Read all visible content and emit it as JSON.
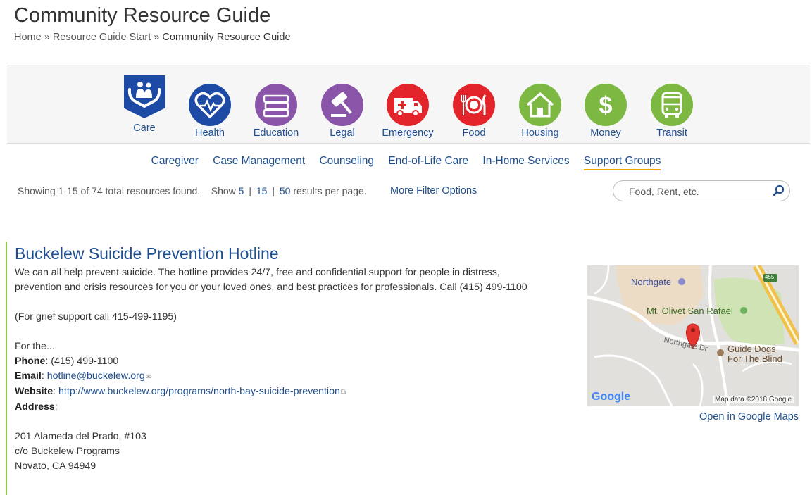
{
  "page": {
    "title": "Community Resource Guide",
    "breadcrumb": {
      "home": "Home",
      "sep1": "»",
      "start": "Resource Guide Start",
      "sep2": "»",
      "current": "Community Resource Guide"
    }
  },
  "categories": [
    {
      "label": "Care",
      "color": "#1d4aa4",
      "icon": "care-hands-icon",
      "active": true
    },
    {
      "label": "Health",
      "color": "#1d4aa4",
      "icon": "heart-pulse-icon"
    },
    {
      "label": "Education",
      "color": "#8a55a9",
      "icon": "books-icon"
    },
    {
      "label": "Legal",
      "color": "#8a55a9",
      "icon": "gavel-icon"
    },
    {
      "label": "Emergency",
      "color": "#e3242b",
      "icon": "ambulance-icon"
    },
    {
      "label": "Food",
      "color": "#e3242b",
      "icon": "plate-utensils-icon"
    },
    {
      "label": "Housing",
      "color": "#7cb842",
      "icon": "house-icon"
    },
    {
      "label": "Money",
      "color": "#7cb842",
      "icon": "dollar-icon"
    },
    {
      "label": "Transit",
      "color": "#7cb842",
      "icon": "bus-icon"
    }
  ],
  "subcategories": [
    {
      "label": "Caregiver"
    },
    {
      "label": "Case Management"
    },
    {
      "label": "Counseling"
    },
    {
      "label": "End-of-Life Care"
    },
    {
      "label": "In-Home Services"
    },
    {
      "label": "Support Groups",
      "selected": true
    }
  ],
  "results": {
    "summary": "Showing 1-15 of 74 total resources found.",
    "show_label": "Show",
    "options": [
      "5",
      "15",
      "50"
    ],
    "divider": "|",
    "suffix": "results per page.",
    "more_filters": "More Filter Options"
  },
  "search": {
    "placeholder": "Food, Rent, etc.",
    "icon": "search-icon"
  },
  "listing": {
    "title": "Buckelew Suicide Prevention Hotline",
    "description": "We can all help prevent suicide. The hotline provides 24/7, free and confidential support for people in distress, prevention and crisis resources for you or your loved ones, and best practices for professionals. Call (415) 499-1100",
    "grief_note": "(For grief support call 415-499-1195)",
    "for_the": "For the...",
    "phone_label": "Phone",
    "phone": "(415) 499-1100",
    "email_label": "Email",
    "email": "hotline@buckelew.org",
    "website_label": "Website",
    "website": "http://www.buckelew.org/programs/north-bay-suicide-prevention",
    "address_label": "Address",
    "address_line1": "201 Alameda del Prado, #103",
    "address_line2": "c/o Buckelew Programs",
    "address_line3": "Novato, CA 94949",
    "colon": ":"
  },
  "map": {
    "labels": {
      "northgate": "Northgate",
      "mt_olivet": "Mt. Olivet San Rafael",
      "northgate_dr": "Northgate Dr",
      "guide_dogs_1": "Guide Dogs",
      "guide_dogs_2": "For The Blind",
      "highway": "455",
      "google": "Google",
      "attribution": "Map data ©2018 Google"
    },
    "open_link": "Open in Google Maps"
  },
  "colors": {
    "link": "#1f4f8f",
    "accent_underline": "#f0a500",
    "listing_border": "#8dc63f",
    "marker": "#e3342f"
  }
}
